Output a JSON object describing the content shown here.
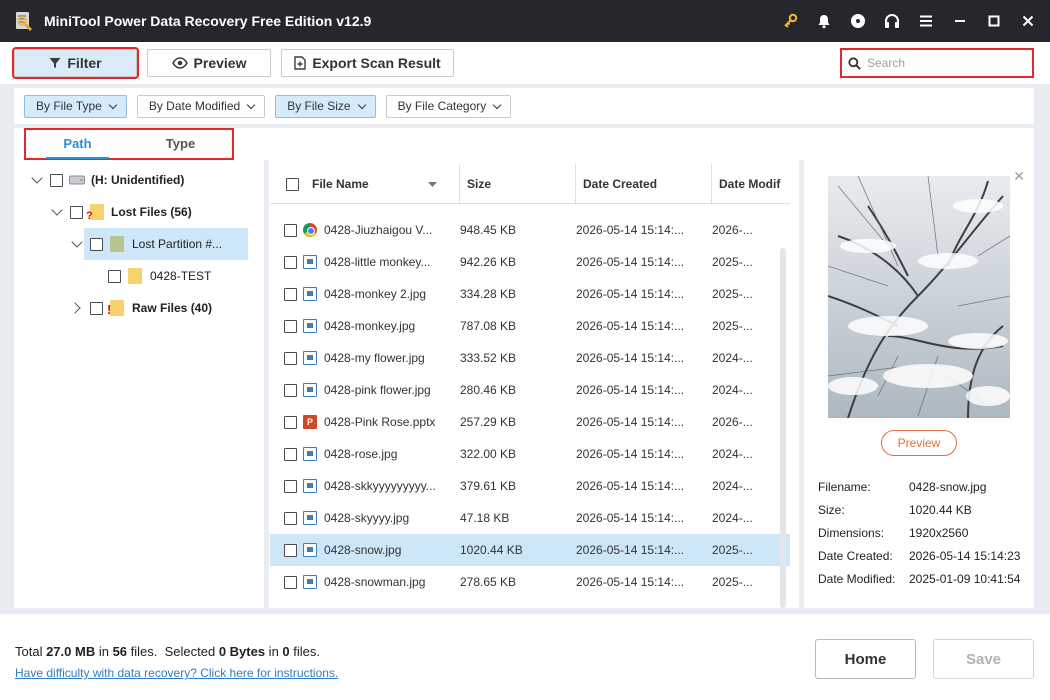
{
  "window": {
    "title": "MiniTool Power Data Recovery Free Edition v12.9"
  },
  "titlebar_icons": [
    "key-icon",
    "bell-icon",
    "disc-icon",
    "headset-icon",
    "menu-icon",
    "minimize-icon",
    "maximize-icon",
    "close-icon"
  ],
  "toolbar": {
    "filter_label": "Filter",
    "preview_label": "Preview",
    "export_label": "Export Scan Result",
    "search_placeholder": "Search"
  },
  "filters": [
    {
      "label": "By File Type",
      "active": true
    },
    {
      "label": "By Date Modified",
      "active": false
    },
    {
      "label": "By File Size",
      "active": true
    },
    {
      "label": "By File Category",
      "active": false
    }
  ],
  "tabs": [
    {
      "label": "Path",
      "active": true
    },
    {
      "label": "Type",
      "active": false
    }
  ],
  "tree": {
    "drive": "(H: Unidentified)",
    "lost_files": "Lost Files (56)",
    "lost_partition": "Lost Partition #...",
    "test_folder": "0428-TEST",
    "raw_files": "Raw Files (40)"
  },
  "table": {
    "headers": {
      "name": "File Name",
      "size": "Size",
      "created": "Date Created",
      "modified": "Date Modif"
    },
    "rows": [
      {
        "icon": "chrome",
        "name": "0428-Jiuzhaigou V...",
        "size": "948.45 KB",
        "created": "2026-05-14 15:14:...",
        "modified": "2026-..."
      },
      {
        "icon": "jpg",
        "name": "0428-little monkey...",
        "size": "942.26 KB",
        "created": "2026-05-14 15:14:...",
        "modified": "2025-..."
      },
      {
        "icon": "jpg",
        "name": "0428-monkey 2.jpg",
        "size": "334.28 KB",
        "created": "2026-05-14 15:14:...",
        "modified": "2025-..."
      },
      {
        "icon": "jpg",
        "name": "0428-monkey.jpg",
        "size": "787.08 KB",
        "created": "2026-05-14 15:14:...",
        "modified": "2025-..."
      },
      {
        "icon": "jpg",
        "name": "0428-my flower.jpg",
        "size": "333.52 KB",
        "created": "2026-05-14 15:14:...",
        "modified": "2024-..."
      },
      {
        "icon": "jpg",
        "name": "0428-pink flower.jpg",
        "size": "280.46 KB",
        "created": "2026-05-14 15:14:...",
        "modified": "2024-..."
      },
      {
        "icon": "pptx",
        "name": "0428-Pink Rose.pptx",
        "size": "257.29 KB",
        "created": "2026-05-14 15:14:...",
        "modified": "2026-..."
      },
      {
        "icon": "jpg",
        "name": "0428-rose.jpg",
        "size": "322.00 KB",
        "created": "2026-05-14 15:14:...",
        "modified": "2024-..."
      },
      {
        "icon": "jpg",
        "name": "0428-skkyyyyyyyyy...",
        "size": "379.61 KB",
        "created": "2026-05-14 15:14:...",
        "modified": "2024-..."
      },
      {
        "icon": "jpg",
        "name": "0428-skyyyy.jpg",
        "size": "47.18 KB",
        "created": "2026-05-14 15:14:...",
        "modified": "2024-..."
      },
      {
        "icon": "jpg",
        "name": "0428-snow.jpg",
        "size": "1020.44 KB",
        "created": "2026-05-14 15:14:...",
        "modified": "2025-...",
        "selected": true
      },
      {
        "icon": "jpg",
        "name": "0428-snowman.jpg",
        "size": "278.65 KB",
        "created": "2026-05-14 15:14:...",
        "modified": "2025-..."
      }
    ]
  },
  "preview": {
    "button_label": "Preview",
    "info": [
      {
        "key": "Filename:",
        "value": "0428-snow.jpg"
      },
      {
        "key": "Size:",
        "value": "1020.44 KB"
      },
      {
        "key": "Dimensions:",
        "value": "1920x2560"
      },
      {
        "key": "Date Created:",
        "value": "2026-05-14 15:14:23"
      },
      {
        "key": "Date Modified:",
        "value": "2025-01-09 10:41:54"
      }
    ]
  },
  "footer": {
    "total_prefix": "Total ",
    "total_size": "27.0 MB",
    "total_mid": " in ",
    "total_files": "56",
    "total_suffix": " files.  Selected ",
    "selected_size": "0 Bytes",
    "selected_mid": " in ",
    "selected_files": "0",
    "selected_suffix": " files.",
    "help_link": "Have difficulty with data recovery? Click here for instructions.",
    "home_label": "Home",
    "save_label": "Save"
  },
  "colors": {
    "accent": "#2e8fd4",
    "highlight_red": "#e3262a",
    "preview_orange": "#e06f3d",
    "titlebar": "#25272c"
  }
}
